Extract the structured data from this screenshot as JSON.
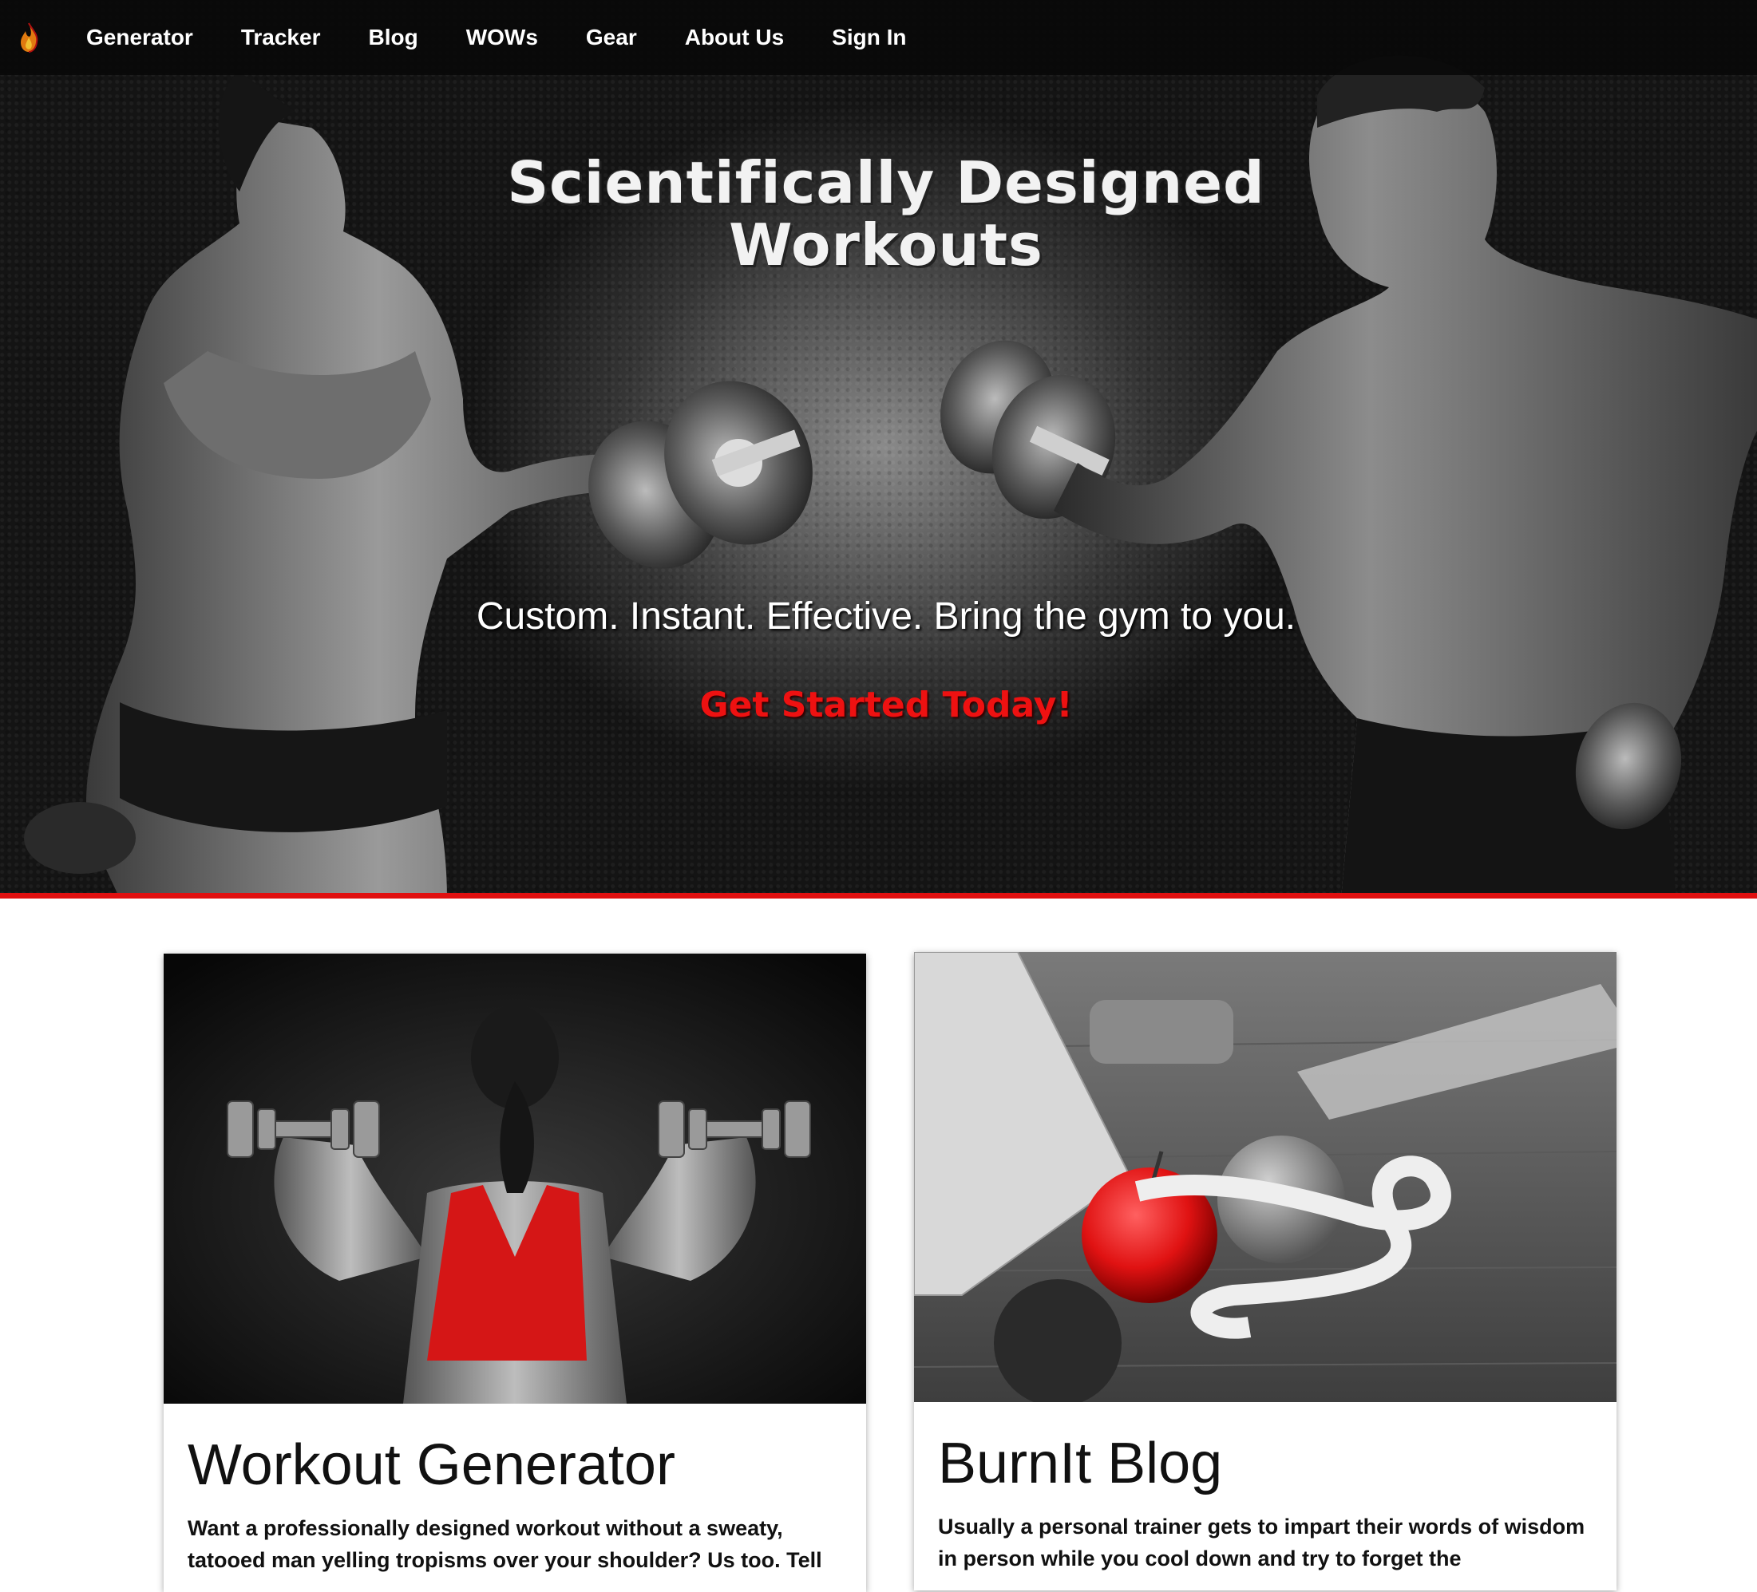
{
  "nav": {
    "logo_icon": "flame-icon",
    "items": [
      {
        "label": "Generator"
      },
      {
        "label": "Tracker"
      },
      {
        "label": "Blog"
      },
      {
        "label": "WOWs"
      },
      {
        "label": "Gear"
      },
      {
        "label": "About Us"
      },
      {
        "label": "Sign In"
      }
    ]
  },
  "hero": {
    "title": "Scientifically Designed Workouts",
    "subtitle": "Custom. Instant. Effective. Bring the gym to you.",
    "cta": "Get Started Today!",
    "accent_color": "#e01010"
  },
  "cards": [
    {
      "title": "Workout Generator",
      "text": "Want a professionally designed workout without a sweaty, tatooed man yelling tropisms over your shoulder? Us too. Tell"
    },
    {
      "title": "BurnIt Blog",
      "text": "Usually a personal trainer gets to impart their words of wisdom in person while you cool down and try to forget the"
    }
  ]
}
